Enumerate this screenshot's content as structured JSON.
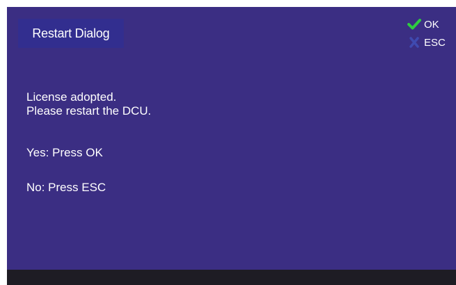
{
  "dialog": {
    "title": "Restart Dialog",
    "message_line1": "License adopted.",
    "message_line2": "Please restart the DCU.",
    "yes_instruction": "Yes: Press OK",
    "no_instruction": "No: Press ESC"
  },
  "hints": {
    "ok_label": "OK",
    "ok_icon": "checkmark-icon",
    "esc_label": "ESC",
    "esc_icon": "x-icon"
  },
  "colors": {
    "background": "#3b2e83",
    "title_box": "#322e8f",
    "ok_icon": "#2ecc40",
    "esc_icon": "#3f4ab0",
    "footer": "#1e1c24",
    "text": "#ffffff"
  }
}
